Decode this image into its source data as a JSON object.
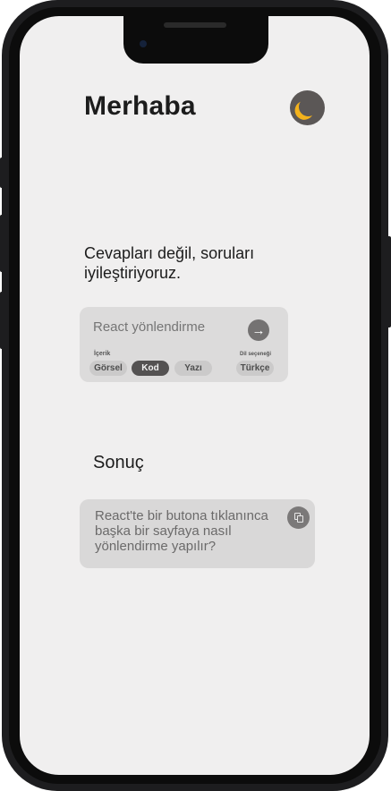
{
  "header": {
    "title": "Merhaba",
    "theme_icon": "moon-icon"
  },
  "hero": {
    "tagline": "Cevapları değil, soruları iyileştiriyoruz."
  },
  "prompt": {
    "placeholder": "React yönlendirme",
    "submit_icon": "arrow-right-icon",
    "submit_glyph": "→",
    "content_label": "İçerik",
    "content_options": [
      "Görsel",
      "Kod",
      "Yazı"
    ],
    "content_selected": "Kod",
    "language_label": "Dil seçeneği",
    "language_value": "Türkçe"
  },
  "result": {
    "title": "Sonuç",
    "text": "React'te bir butona tıklanınca başka bir sayfaya nasıl yönlendirme yapılır?",
    "copy_icon": "copy-icon"
  },
  "colors": {
    "background": "#f0efef",
    "card": "#dcdbdb",
    "accent_moon": "#f3b21c",
    "chip_active": "#545252"
  }
}
